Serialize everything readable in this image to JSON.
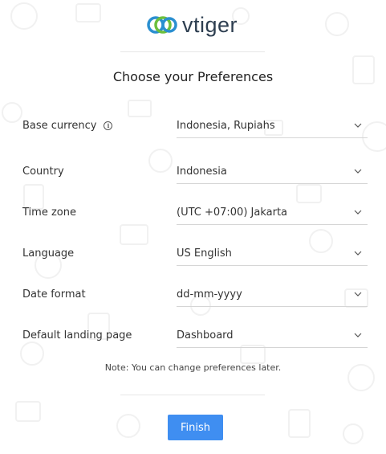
{
  "brand": {
    "name": "vtiger"
  },
  "heading": "Choose your Preferences",
  "fields": [
    {
      "label": "Base currency",
      "value": "Indonesia, Rupiahs",
      "has_info": true
    },
    {
      "label": "Country",
      "value": "Indonesia"
    },
    {
      "label": "Time zone",
      "value": "(UTC +07:00) Jakarta"
    },
    {
      "label": "Language",
      "value": "US English"
    },
    {
      "label": "Date format",
      "value": "dd-mm-yyyy"
    },
    {
      "label": "Default landing page",
      "value": "Dashboard"
    }
  ],
  "note": "Note: You can change preferences later.",
  "finish_label": "Finish",
  "colors": {
    "accent": "#3f8ef1",
    "logo_blue": "#2a8fd0",
    "logo_green": "#6cbf3c",
    "text": "#2d3e50"
  },
  "icons": {
    "info": "info-icon",
    "dropdown": "chevron-down-icon"
  }
}
